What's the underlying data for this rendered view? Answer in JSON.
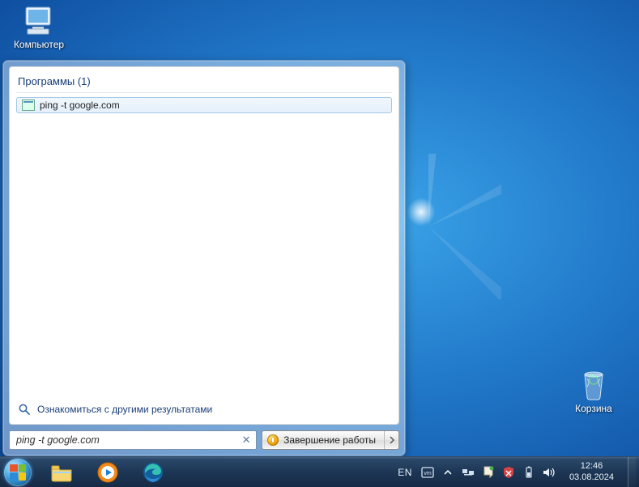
{
  "desktop": {
    "computer_label": "Компьютер",
    "recycle_label": "Корзина"
  },
  "start_menu": {
    "programs_header": "Программы (1)",
    "result_label": "ping -t google.com",
    "see_more": "Ознакомиться с другими результатами",
    "search_value": "ping -t google.com",
    "shutdown_label": "Завершение работы"
  },
  "taskbar": {
    "lang": "EN",
    "time": "12:46",
    "date": "03.08.2024"
  }
}
